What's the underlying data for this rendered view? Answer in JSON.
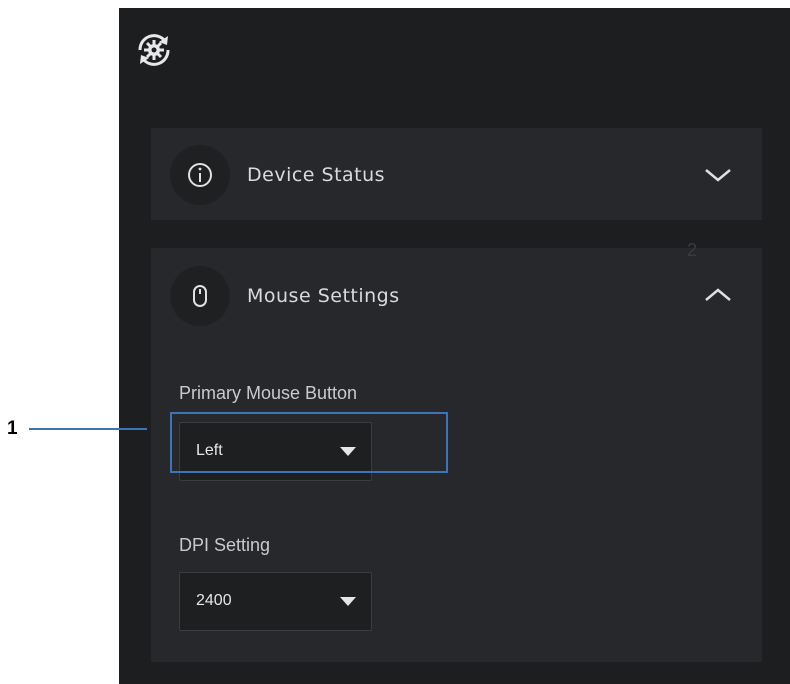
{
  "app": {
    "icon": "settings-sync-icon"
  },
  "device_status": {
    "title": "Device Status",
    "icon": "info-icon",
    "chevron": "chevron-down-icon",
    "expanded": false
  },
  "mouse_settings": {
    "title": "Mouse Settings",
    "icon": "mouse-icon",
    "chevron": "chevron-up-icon",
    "expanded": true,
    "primary_button": {
      "label": "Primary Mouse Button",
      "value": "Left"
    },
    "dpi": {
      "label": "DPI Setting",
      "value": "2400"
    }
  },
  "callouts": {
    "one": "1",
    "two": "2"
  },
  "colors": {
    "panel": "#1d1e20",
    "card": "#26282b",
    "callout": "#3d73b8"
  }
}
